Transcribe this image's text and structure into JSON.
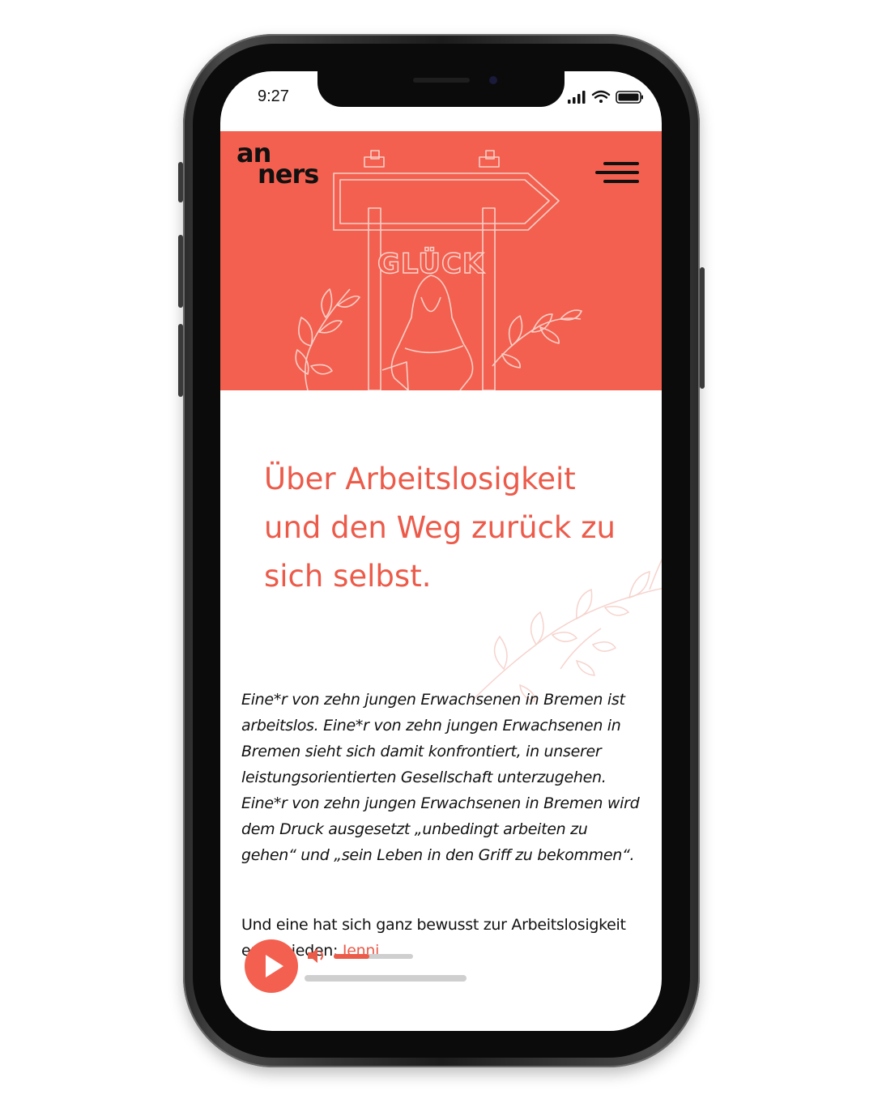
{
  "status_bar": {
    "time": "9:27"
  },
  "hero": {
    "logo_line1": "an",
    "logo_line2": "ners",
    "sign_text": "GLÜCK",
    "background_color": "#f4604f"
  },
  "article": {
    "headline": "Über Arbeitslosigkeit und den Weg zurück zu sich selbst.",
    "intro": "Eine*r von zehn jungen Erwachsenen in Bremen ist arbeitslos. Eine*r von zehn jungen Erwachsenen in Bremen sieht sich damit konfrontiert, in unserer leistungsorientierten Gesellschaft unterzugehen. Eine*r von zehn jungen Erwachsenen in Bremen wird dem Druck ausgesetzt „unbedingt arbeiten zu gehen“ und „sein Leben in den Griff zu bekommen“.",
    "paragraph2": "Und eine hat sich ganz bewusst zur Arbeitslosigkeit",
    "paragraph2_cut": "entschieden:",
    "paragraph2_link": "Jenni",
    "accent_color": "#ec5b4a"
  },
  "audio_player": {
    "volume_level": 0.45,
    "playback_progress": 0,
    "icons": [
      "play-icon",
      "volume-icon"
    ]
  },
  "icons": [
    "menu-icon",
    "signal-icon",
    "wifi-icon",
    "battery-icon"
  ]
}
